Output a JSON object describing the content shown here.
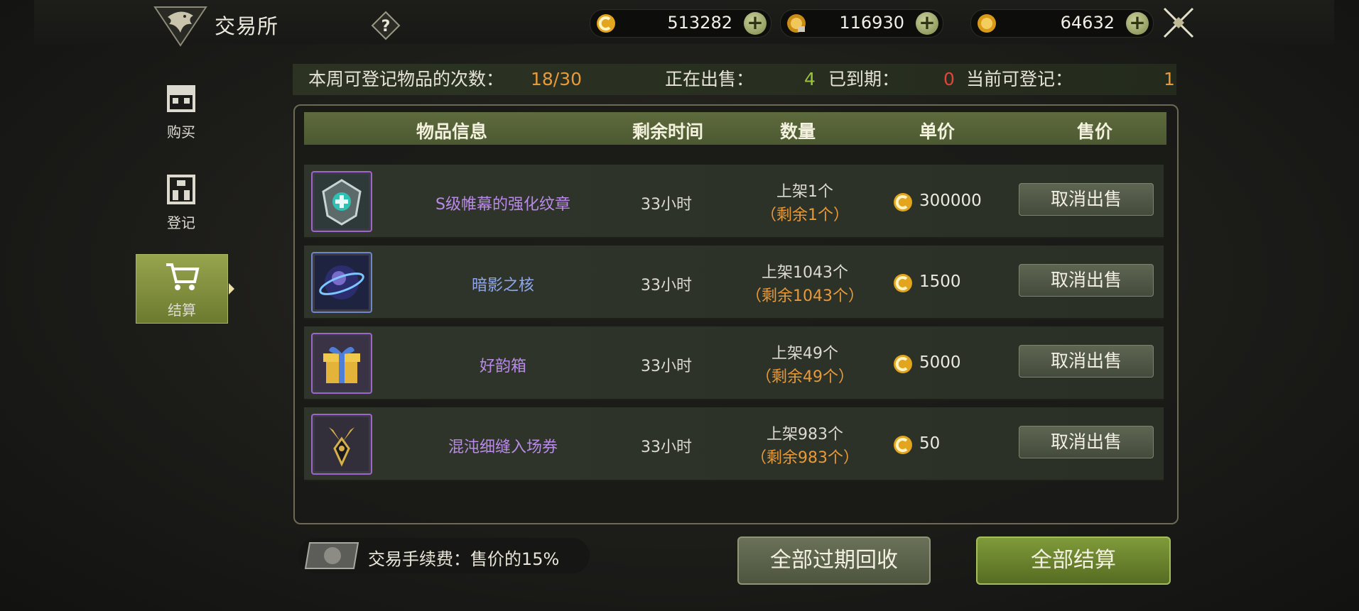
{
  "header": {
    "title": "交易所",
    "help_icon": "question-icon",
    "currencies": [
      {
        "icon": "gold-c-coin-icon",
        "value": "513282",
        "plus": "+"
      },
      {
        "icon": "gold-ingot-coin-icon",
        "value": "116930",
        "plus": "+"
      },
      {
        "icon": "gold-coin-icon",
        "value": "64632",
        "plus": "+"
      }
    ],
    "close_icon": "crossed-swords-icon"
  },
  "sidebar": {
    "tabs": [
      {
        "label": "购买",
        "icon": "shop-icon",
        "active": false
      },
      {
        "label": "登记",
        "icon": "building-icon",
        "active": false
      },
      {
        "label": "结算",
        "icon": "cart-icon",
        "active": true
      }
    ]
  },
  "stats": {
    "weekly_label": "本周可登记物品的次数：",
    "weekly_value": "18/30",
    "selling_label": "正在出售：",
    "selling_value": "4",
    "expired_label": "已到期：",
    "expired_value": "0",
    "available_label": "当前可登记：",
    "available_value": "1"
  },
  "table": {
    "headers": [
      "物品信息",
      "剩余时间",
      "数量",
      "单价",
      "售价"
    ],
    "rows": [
      {
        "name": "S级帷幕的强化纹章",
        "name_color": "#b98ae8",
        "time": "33小时",
        "listed": "上架1个",
        "remaining": "（剩余1个）",
        "price": "300000",
        "button": "取消出售",
        "icon": "emblem-shield-icon"
      },
      {
        "name": "暗影之核",
        "name_color": "#8ea6ee",
        "time": "33小时",
        "listed": "上架1043个",
        "remaining": "（剩余1043个）",
        "price": "1500",
        "button": "取消出售",
        "icon": "shadow-orb-icon"
      },
      {
        "name": "好韵箱",
        "name_color": "#b98ae8",
        "time": "33小时",
        "listed": "上架49个",
        "remaining": "（剩余49个）",
        "price": "5000",
        "button": "取消出售",
        "icon": "gift-box-icon"
      },
      {
        "name": "混沌细缝入场券",
        "name_color": "#b98ae8",
        "time": "33小时",
        "listed": "上架983个",
        "remaining": "（剩余983个）",
        "price": "50",
        "button": "取消出售",
        "icon": "ticket-icon"
      }
    ]
  },
  "footer": {
    "fee_text": "交易手续费：售价的15%",
    "recycle_button": "全部过期回收",
    "settle_button": "全部结算"
  },
  "colors": {
    "accent_green": "#7f9a3a",
    "orange": "#e89a3a",
    "red": "#e0453a",
    "purple_item": "#b98ae8",
    "blue_item": "#8ea6ee"
  }
}
